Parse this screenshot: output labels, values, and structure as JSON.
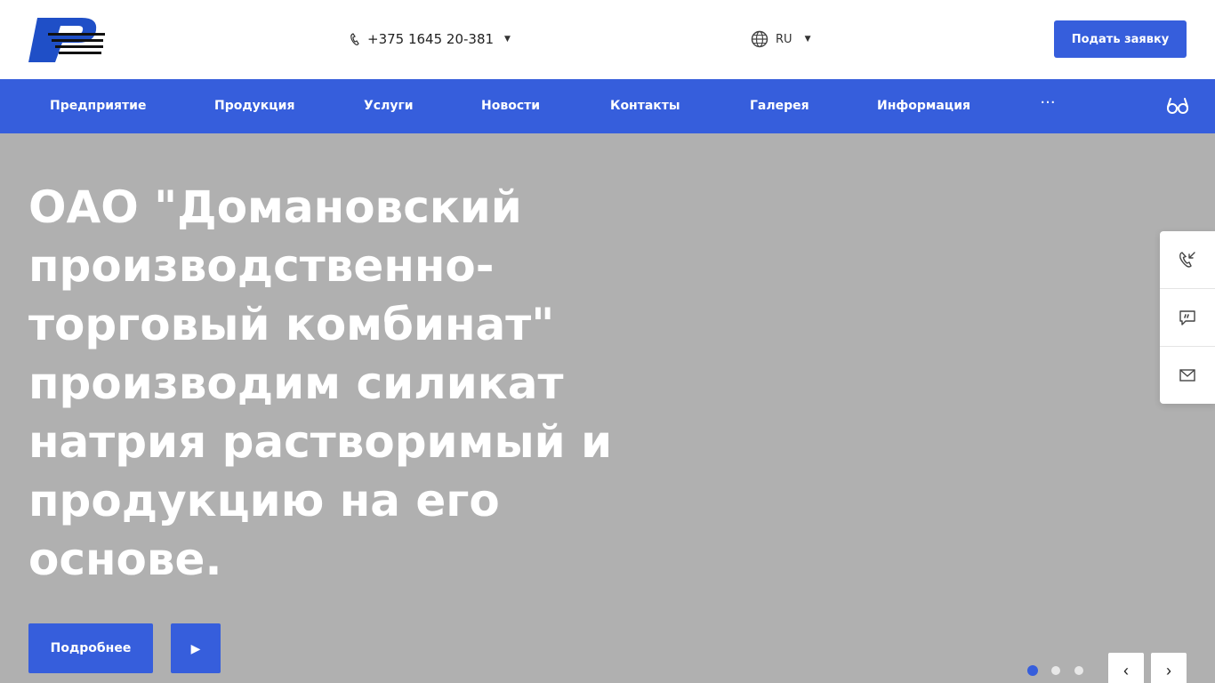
{
  "header": {
    "phone": "+375 1645 20-381",
    "language": "RU",
    "cta_label": "Подать заявку"
  },
  "nav": {
    "items": [
      "Предприятие",
      "Продукция",
      "Услуги",
      "Новости",
      "Контакты",
      "Галерея",
      "Информация"
    ],
    "more": "···"
  },
  "hero": {
    "title": "ОАО \"Домановский производственно-торговый комбинат\" производим силикат натрия растворимый и продукцию на его основе.",
    "more_label": "Подробнее",
    "play": "▶"
  },
  "slider": {
    "prev": "‹",
    "next": "›",
    "active_index": 0,
    "count": 3
  },
  "colors": {
    "accent": "#365edc",
    "hero_bg": "#b0b0b0"
  }
}
